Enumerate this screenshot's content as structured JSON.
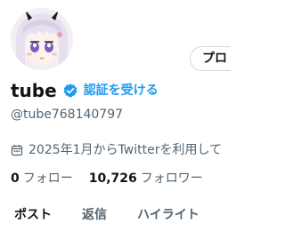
{
  "profile": {
    "display_name": "tube",
    "verify_label": "認証を受ける",
    "handle": "@tube768140797",
    "joined": "2025年1月からTwitterを利用して",
    "following_count": "0",
    "following_label": "フォロー",
    "followers_count": "10,726",
    "followers_label": "フォロワー",
    "profile_button_label": "プロ"
  },
  "tabs": [
    {
      "label": "ポスト"
    },
    {
      "label": "返信"
    },
    {
      "label": "ハイライト"
    }
  ],
  "colors": {
    "accent": "#1d9bf0",
    "text_primary": "#0f1419",
    "text_secondary": "#536471",
    "border": "#cfd9de"
  },
  "icons": {
    "verified": "verified-badge-icon",
    "calendar": "calendar-icon"
  }
}
